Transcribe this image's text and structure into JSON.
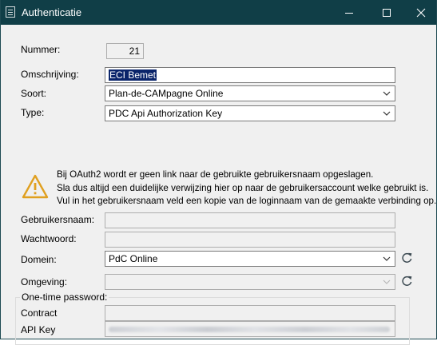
{
  "window": {
    "title": "Authenticatie",
    "icon": "document-icon",
    "controls": [
      "minimize",
      "maximize",
      "close"
    ]
  },
  "form": {
    "nummer": {
      "label": "Nummer:",
      "value": "21"
    },
    "omschrijving": {
      "label": "Omschrijving:",
      "value": "ECI Bemet"
    },
    "soort": {
      "label": "Soort:",
      "value": "Plan-de-CAMpagne Online"
    },
    "type": {
      "label": "Type:",
      "value": "PDC Api Authorization Key"
    }
  },
  "warning": {
    "icon": "warning-icon",
    "line1": "Bij OAuth2 wordt er geen link naar de gebruikte gebruikersnaam opgeslagen.",
    "line2": "Sla dus altijd een duidelijke verwijzing hier op naar de gebruikersaccount welke gebruikt is.",
    "line3": "Vul in het gebruikersnaam veld een kopie van de loginnaam van de gemaakte verbinding op."
  },
  "credentials": {
    "gebruikersnaam": {
      "label": "Gebruikersnaam:",
      "value": ""
    },
    "wachtwoord": {
      "label": "Wachtwoord:",
      "value": ""
    },
    "domein": {
      "label": "Domein:",
      "value": "PdC Online"
    },
    "omgeving": {
      "label": "Omgeving:",
      "value": ""
    }
  },
  "otp": {
    "legend": "One-time password:",
    "contract": {
      "label": "Contract",
      "value": ""
    },
    "api_key": {
      "label": "API Key",
      "value_obscured": true
    }
  },
  "colors": {
    "titlebar": "#103e47",
    "selection": "#0a246a",
    "window_bg": "#f0f0f0",
    "refresh_icon": "#3c4a52"
  }
}
